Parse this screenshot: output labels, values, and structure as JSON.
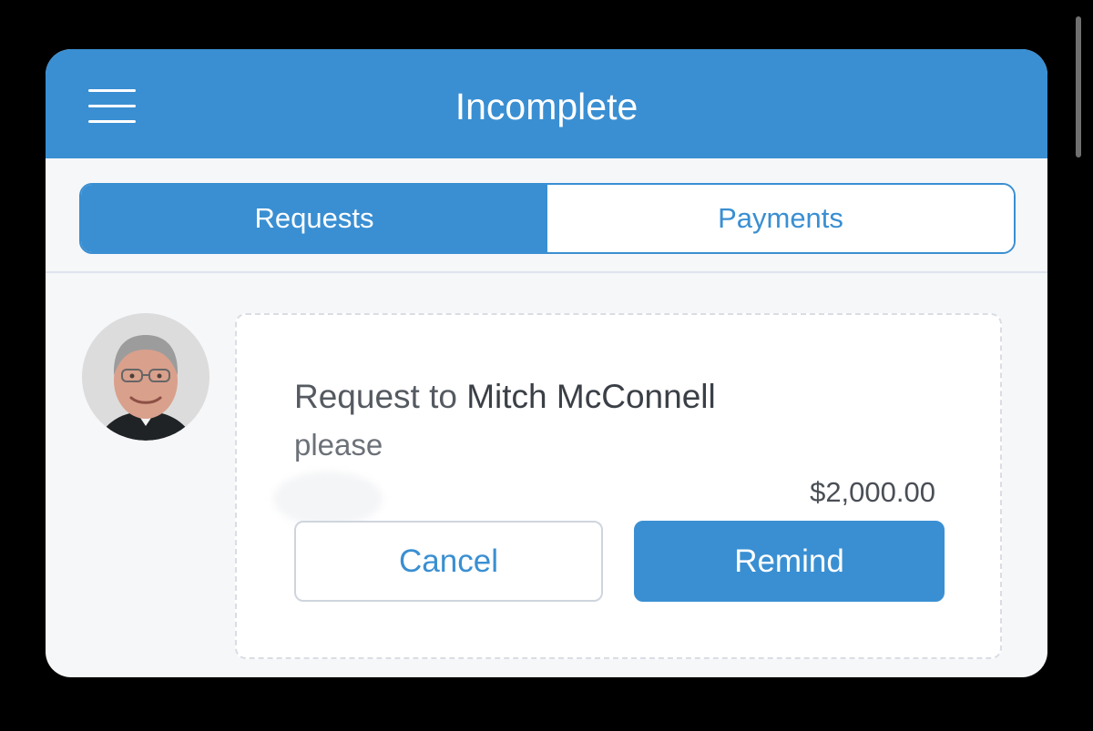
{
  "header": {
    "title": "Incomplete",
    "menu_icon": "hamburger-menu-icon"
  },
  "tabs": [
    {
      "label": "Requests",
      "active": true
    },
    {
      "label": "Payments",
      "active": false
    }
  ],
  "request": {
    "prefix": "Request to ",
    "recipient": "Mitch McConnell",
    "note": "please",
    "amount": "$2,000.00",
    "cancel_label": "Cancel",
    "remind_label": "Remind"
  },
  "colors": {
    "accent": "#3a8fd2",
    "background": "#000000",
    "card_background": "#f6f7f9"
  }
}
